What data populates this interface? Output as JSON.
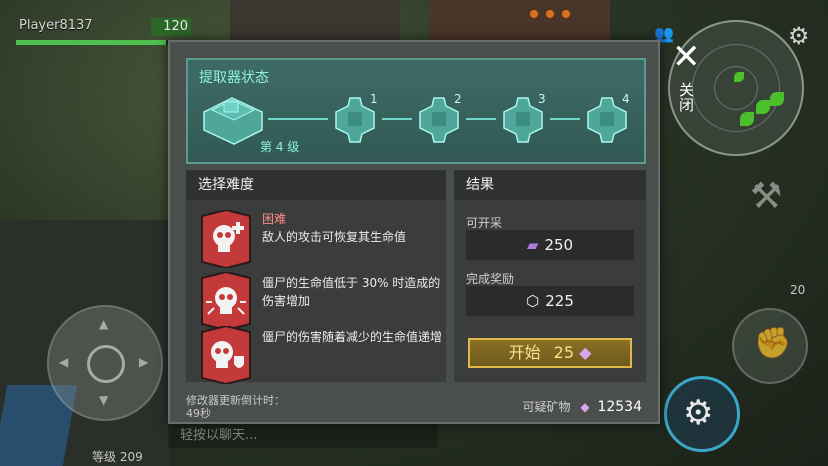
{
  "hud": {
    "player_name": "Player8137",
    "player_level_value": "120",
    "level_label": "等级 209",
    "ammo_count": "20",
    "chat_placeholder": "轻按以聊天..."
  },
  "minimap": {
    "close_label": "关闭"
  },
  "dialog": {
    "status": {
      "title": "提取器状态",
      "tier_label": "第 4 级",
      "nodes": [
        "1",
        "2",
        "3",
        "4"
      ]
    },
    "difficulty": {
      "header": "选择难度",
      "level_title": "困难",
      "modifiers": [
        {
          "icon": "skull-heal-icon",
          "text": "敌人的攻击可恢复其生命值"
        },
        {
          "icon": "skull-burst-icon",
          "text": "僵尸的生命值低于 30% 时造成的伤害增加"
        },
        {
          "icon": "skull-shield-icon",
          "text": "僵尸的伤害随着减少的生命值递增"
        }
      ]
    },
    "result": {
      "header": "结果",
      "mineable_label": "可开采",
      "mineable_value": "250",
      "reward_label": "完成奖励",
      "reward_value": "225",
      "start_label": "开始",
      "start_cost": "25"
    },
    "footer": {
      "timer_label": "修改器更新倒计时：",
      "timer_value": "49秒",
      "ore_label": "可疑矿物",
      "ore_value": "12534"
    }
  },
  "colors": {
    "accent_teal": "#8ef0df",
    "danger_red": "#c43a3a",
    "start_gold": "#e0b84a"
  }
}
